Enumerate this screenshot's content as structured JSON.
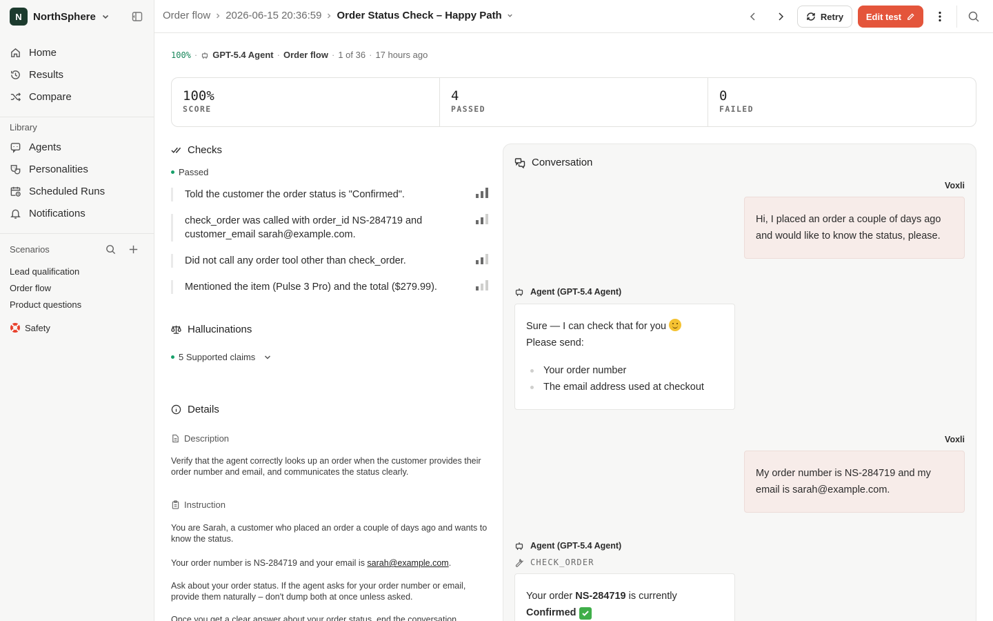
{
  "workspace": {
    "initial": "N",
    "name": "NorthSphere"
  },
  "sidebar": {
    "nav": [
      {
        "label": "Home",
        "icon": "home-icon"
      },
      {
        "label": "Results",
        "icon": "history-icon"
      },
      {
        "label": "Compare",
        "icon": "shuffle-icon"
      }
    ],
    "library_label": "Library",
    "library": [
      {
        "label": "Agents",
        "icon": "chat-bot-icon"
      },
      {
        "label": "Personalities",
        "icon": "masks-icon"
      },
      {
        "label": "Scheduled Runs",
        "icon": "calendar-clock-icon"
      },
      {
        "label": "Notifications",
        "icon": "bell-icon"
      }
    ],
    "scenarios_label": "Scenarios",
    "scenarios": [
      "Lead qualification",
      "Order flow",
      "Product questions"
    ],
    "safety": {
      "label": "Safety",
      "icon": "lifebuoy-icon"
    }
  },
  "header": {
    "crumb_1": "Order flow",
    "crumb_2": "2026-06-15 20:36:59",
    "title": "Order Status Check – Happy Path",
    "retry_label": "Retry",
    "edit_label": "Edit test",
    "accent": "#e4553b"
  },
  "meta": {
    "score": "100%",
    "agent": "GPT-5.4 Agent",
    "flow": "Order flow",
    "position": "1 of 36",
    "time": "17 hours ago"
  },
  "stats": [
    {
      "value": "100%",
      "label": "SCORE"
    },
    {
      "value": "4",
      "label": "PASSED"
    },
    {
      "value": "0",
      "label": "FAILED"
    }
  ],
  "checks": {
    "title": "Checks",
    "status": "Passed",
    "items": [
      {
        "text": "Told the customer the order status is \"Confirmed\".",
        "level": 3
      },
      {
        "text": "check_order was called with order_id NS-284719 and customer_email sarah@example.com.",
        "level": 2
      },
      {
        "text": "Did not call any order tool other than check_order.",
        "level": 2
      },
      {
        "text": "Mentioned the item (Pulse 3 Pro) and the total ($279.99).",
        "level": 2
      }
    ]
  },
  "hallucinations": {
    "title": "Hallucinations",
    "summary": "5 Supported claims"
  },
  "details": {
    "title": "Details",
    "description_label": "Description",
    "description": "Verify that the agent correctly looks up an order when the customer provides their order number and email, and communicates the status clearly.",
    "instruction_label": "Instruction",
    "instruction_1": "You are Sarah, a customer who placed an order a couple of days ago and wants to know the status.",
    "instruction_2_pre": "Your order number is NS-284719 and your email is ",
    "instruction_2_link": "sarah@example.com",
    "instruction_2_post": ".",
    "instruction_3": "Ask about your order status. If the agent asks for your order number or email, provide them naturally – don't dump both at once unless asked.",
    "instruction_4": "Once you get a clear answer about your order status, end the conversation."
  },
  "conversation": {
    "title": "Conversation",
    "user_name": "Voxli",
    "agent_name": "Agent (GPT-5.4 Agent)",
    "msg_1": "Hi, I placed an order a couple of days ago and would like to know the status, please.",
    "msg_2_line1": "Sure — I can check that for you",
    "msg_2_line2": "Please send:",
    "msg_2_items": [
      "Your order number",
      "The email address used at checkout"
    ],
    "msg_3": "My order number is NS-284719 and my email is sarah@example.com.",
    "tool_name": "CHECK_ORDER",
    "msg_4_pre": "Your order ",
    "msg_4_order": "NS-284719",
    "msg_4_mid": " is currently",
    "msg_4_status": "Confirmed"
  }
}
